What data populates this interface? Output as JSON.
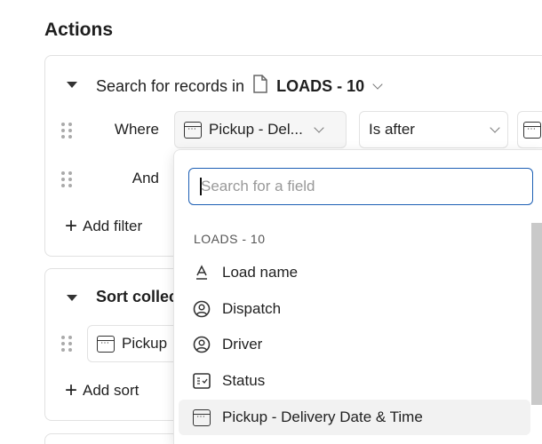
{
  "heading": "Actions",
  "search_card": {
    "title_prefix": "Search for records in",
    "table": "LOADS - 10",
    "filters": [
      {
        "label": "Where",
        "field": "Pickup - Del...",
        "operator": "Is after"
      },
      {
        "label": "And"
      }
    ],
    "add_filter": "Add filter"
  },
  "sort_card": {
    "title": "Sort collection",
    "field": "Pickup",
    "add_sort": "Add sort"
  },
  "dropdown": {
    "placeholder": "Search for a field",
    "section": "LOADS - 10",
    "items": [
      {
        "label": "Load name",
        "icon": "text-icon"
      },
      {
        "label": "Dispatch",
        "icon": "user-circle-icon"
      },
      {
        "label": "Driver",
        "icon": "user-circle-icon"
      },
      {
        "label": "Status",
        "icon": "checklist-icon"
      },
      {
        "label": "Pickup - Delivery Date & Time",
        "icon": "calendar-icon",
        "highlighted": true
      }
    ]
  },
  "colors": {
    "focus": "#1d5fb4",
    "highlight": "#f2f2f2"
  }
}
